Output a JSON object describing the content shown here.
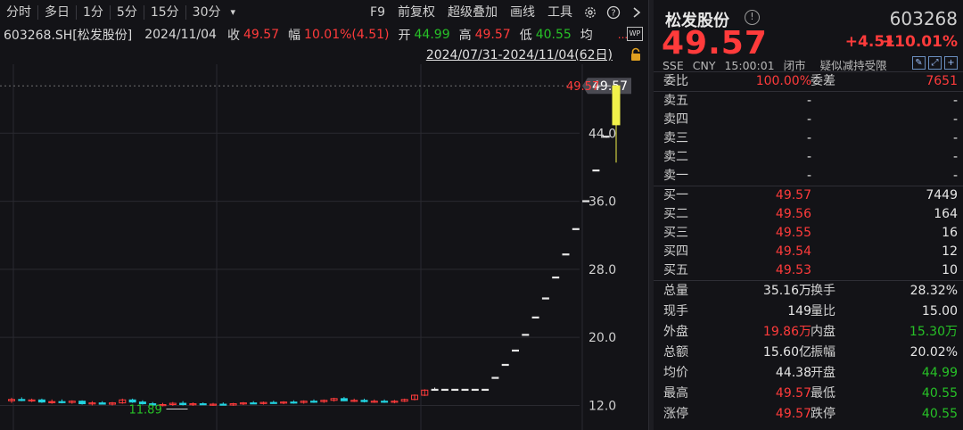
{
  "toolbar": {
    "periods": [
      "分时",
      "多日",
      "1分",
      "5分",
      "15分",
      "30分"
    ],
    "dropdown_glyph": "▾",
    "right_items": [
      "F9",
      "前复权",
      "超级叠加",
      "画线",
      "工具"
    ]
  },
  "infobar": {
    "symbol": "603268.SH[松发股份]",
    "date": "2024/11/04",
    "close_label": "收",
    "close": "49.57",
    "range_label": "幅",
    "range": "10.01%(4.51)",
    "open_label": "开",
    "open": "44.99",
    "high_label": "高",
    "high": "49.57",
    "low_label": "低",
    "low": "40.55",
    "avg_label": "均",
    "more": "...",
    "wp": "WP"
  },
  "range": {
    "text": "2024/07/31-2024/11/04(62日)"
  },
  "colors": {
    "up": "#ff3b3b",
    "down": "#27c127",
    "flat": "#22d3e0",
    "bg": "#131317",
    "grid": "#2a2a30"
  },
  "chart_data": {
    "type": "candlestick",
    "y_ticks": [
      "49.57",
      "44.0",
      "36.0",
      "28.0",
      "20.0",
      "12.0"
    ],
    "y_tick_values": [
      49.57,
      44.0,
      36.0,
      28.0,
      20.0,
      12.0
    ],
    "ylim": [
      11.0,
      49.8
    ],
    "last_price_label": "49.57",
    "high_marker": "49.57",
    "low_marker": "11.89",
    "candles": [
      {
        "o": 12.55,
        "h": 12.9,
        "l": 12.3,
        "c": 12.7
      },
      {
        "o": 12.7,
        "h": 12.95,
        "l": 12.5,
        "c": 12.6
      },
      {
        "o": 12.6,
        "h": 12.8,
        "l": 12.4,
        "c": 12.65
      },
      {
        "o": 12.65,
        "h": 12.8,
        "l": 12.3,
        "c": 12.4
      },
      {
        "o": 12.45,
        "h": 12.7,
        "l": 12.2,
        "c": 12.45
      },
      {
        "o": 12.45,
        "h": 12.7,
        "l": 12.25,
        "c": 12.35
      },
      {
        "o": 12.35,
        "h": 12.6,
        "l": 12.2,
        "c": 12.5
      },
      {
        "o": 12.5,
        "h": 12.6,
        "l": 12.1,
        "c": 12.2
      },
      {
        "o": 12.2,
        "h": 12.5,
        "l": 12.0,
        "c": 12.3
      },
      {
        "o": 12.3,
        "h": 12.5,
        "l": 12.1,
        "c": 12.15
      },
      {
        "o": 12.15,
        "h": 12.4,
        "l": 12.0,
        "c": 12.3
      },
      {
        "o": 12.3,
        "h": 12.8,
        "l": 12.2,
        "c": 12.65
      },
      {
        "o": 12.65,
        "h": 12.8,
        "l": 12.3,
        "c": 12.4
      },
      {
        "o": 12.4,
        "h": 12.6,
        "l": 12.1,
        "c": 12.2
      },
      {
        "o": 12.2,
        "h": 12.4,
        "l": 11.95,
        "c": 12.05
      },
      {
        "o": 12.05,
        "h": 12.3,
        "l": 11.89,
        "c": 12.1
      },
      {
        "o": 12.1,
        "h": 12.4,
        "l": 11.95,
        "c": 12.25
      },
      {
        "o": 12.25,
        "h": 12.5,
        "l": 12.0,
        "c": 12.1
      },
      {
        "o": 12.1,
        "h": 12.35,
        "l": 11.95,
        "c": 12.2
      },
      {
        "o": 12.2,
        "h": 12.35,
        "l": 12.05,
        "c": 12.1
      },
      {
        "o": 12.1,
        "h": 12.3,
        "l": 11.95,
        "c": 12.15
      },
      {
        "o": 12.15,
        "h": 12.35,
        "l": 12.0,
        "c": 12.05
      },
      {
        "o": 12.05,
        "h": 12.3,
        "l": 11.95,
        "c": 12.2
      },
      {
        "o": 12.2,
        "h": 12.4,
        "l": 12.05,
        "c": 12.3
      },
      {
        "o": 12.3,
        "h": 12.5,
        "l": 12.15,
        "c": 12.25
      },
      {
        "o": 12.25,
        "h": 12.45,
        "l": 12.1,
        "c": 12.35
      },
      {
        "o": 12.35,
        "h": 12.55,
        "l": 12.2,
        "c": 12.3
      },
      {
        "o": 12.3,
        "h": 12.5,
        "l": 12.15,
        "c": 12.4
      },
      {
        "o": 12.4,
        "h": 12.6,
        "l": 12.2,
        "c": 12.35
      },
      {
        "o": 12.35,
        "h": 12.6,
        "l": 12.2,
        "c": 12.5
      },
      {
        "o": 12.5,
        "h": 12.7,
        "l": 12.3,
        "c": 12.45
      },
      {
        "o": 12.45,
        "h": 12.7,
        "l": 12.3,
        "c": 12.6
      },
      {
        "o": 12.6,
        "h": 12.9,
        "l": 12.45,
        "c": 12.8
      },
      {
        "o": 12.8,
        "h": 13.0,
        "l": 12.5,
        "c": 12.55
      },
      {
        "o": 12.55,
        "h": 12.8,
        "l": 12.4,
        "c": 12.6
      },
      {
        "o": 12.6,
        "h": 12.8,
        "l": 12.35,
        "c": 12.45
      },
      {
        "o": 12.45,
        "h": 12.7,
        "l": 12.3,
        "c": 12.5
      },
      {
        "o": 12.5,
        "h": 12.7,
        "l": 12.3,
        "c": 12.4
      },
      {
        "o": 12.4,
        "h": 12.65,
        "l": 12.25,
        "c": 12.5
      },
      {
        "o": 12.5,
        "h": 12.8,
        "l": 12.4,
        "c": 12.7
      },
      {
        "o": 12.7,
        "h": 13.3,
        "l": 12.6,
        "c": 13.2
      },
      {
        "o": 13.2,
        "h": 13.9,
        "l": 13.1,
        "c": 13.8
      },
      {
        "o": 13.9,
        "h": 14.1,
        "l": 13.9,
        "c": 13.9
      },
      {
        "o": 13.9,
        "h": 13.9,
        "l": 13.9,
        "c": 13.9
      },
      {
        "o": 13.9,
        "h": 13.9,
        "l": 13.9,
        "c": 13.9
      },
      {
        "o": 13.9,
        "h": 13.9,
        "l": 13.9,
        "c": 13.9
      },
      {
        "o": 13.9,
        "h": 13.9,
        "l": 13.9,
        "c": 13.9
      },
      {
        "o": 13.9,
        "h": 13.9,
        "l": 13.9,
        "c": 13.9
      },
      {
        "o": 15.3,
        "h": 15.3,
        "l": 15.3,
        "c": 15.3
      },
      {
        "o": 16.83,
        "h": 16.83,
        "l": 16.83,
        "c": 16.83
      },
      {
        "o": 18.51,
        "h": 18.51,
        "l": 18.51,
        "c": 18.51
      },
      {
        "o": 20.36,
        "h": 20.36,
        "l": 20.36,
        "c": 20.36
      },
      {
        "o": 22.4,
        "h": 22.4,
        "l": 22.4,
        "c": 22.4
      },
      {
        "o": 24.64,
        "h": 24.64,
        "l": 24.64,
        "c": 24.64
      },
      {
        "o": 27.1,
        "h": 27.1,
        "l": 27.1,
        "c": 27.1
      },
      {
        "o": 29.81,
        "h": 29.81,
        "l": 29.81,
        "c": 29.81
      },
      {
        "o": 32.79,
        "h": 32.79,
        "l": 32.79,
        "c": 32.79
      },
      {
        "o": 36.07,
        "h": 36.07,
        "l": 36.07,
        "c": 36.07
      },
      {
        "o": 39.68,
        "h": 39.68,
        "l": 39.68,
        "c": 39.68
      },
      {
        "o": 43.65,
        "h": 43.65,
        "l": 43.65,
        "c": 43.65
      },
      {
        "o": 44.99,
        "h": 49.57,
        "l": 40.55,
        "c": 49.57
      }
    ]
  },
  "quote": {
    "name": "松发股份",
    "info_icon": "!",
    "code": "603268",
    "price": "49.57",
    "change": "+4.51",
    "pct": "+10.01%",
    "meta": [
      "SSE",
      "CNY",
      "15:00:01",
      "闭市",
      "疑似减持受限"
    ],
    "wb_label": "委比",
    "wb": "100.00%",
    "wc_label": "委差",
    "wc": "7651",
    "sells": [
      {
        "label": "卖五",
        "price": "-",
        "vol": "-"
      },
      {
        "label": "卖四",
        "price": "-",
        "vol": "-"
      },
      {
        "label": "卖三",
        "price": "-",
        "vol": "-"
      },
      {
        "label": "卖二",
        "price": "-",
        "vol": "-"
      },
      {
        "label": "卖一",
        "price": "-",
        "vol": "-"
      }
    ],
    "buys": [
      {
        "label": "买一",
        "price": "49.57",
        "vol": "7449"
      },
      {
        "label": "买二",
        "price": "49.56",
        "vol": "164"
      },
      {
        "label": "买三",
        "price": "49.55",
        "vol": "16"
      },
      {
        "label": "买四",
        "price": "49.54",
        "vol": "12"
      },
      {
        "label": "买五",
        "price": "49.53",
        "vol": "10"
      }
    ],
    "stats": [
      {
        "l1": "总量",
        "v1": "35.16万",
        "c1": "white",
        "l2": "换手",
        "v2": "28.32%",
        "c2": "white"
      },
      {
        "l1": "现手",
        "v1": "149",
        "c1": "white",
        "l2": "量比",
        "v2": "15.00",
        "c2": "white"
      },
      {
        "l1": "外盘",
        "v1": "19.86万",
        "c1": "red",
        "l2": "内盘",
        "v2": "15.30万",
        "c2": "green"
      },
      {
        "l1": "总额",
        "v1": "15.60亿",
        "c1": "white",
        "l2": "振幅",
        "v2": "20.02%",
        "c2": "white"
      },
      {
        "l1": "均价",
        "v1": "44.38",
        "c1": "white",
        "l2": "开盘",
        "v2": "44.99",
        "c2": "green"
      },
      {
        "l1": "最高",
        "v1": "49.57",
        "c1": "red",
        "l2": "最低",
        "v2": "40.55",
        "c2": "green"
      },
      {
        "l1": "涨停",
        "v1": "49.57",
        "c1": "red",
        "l2": "跌停",
        "v2": "40.55",
        "c2": "green"
      }
    ]
  }
}
